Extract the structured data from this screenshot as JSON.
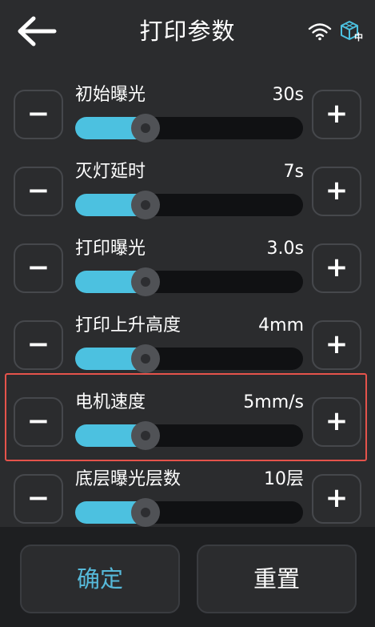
{
  "header": {
    "title": "打印参数",
    "back_icon": "back-arrow-icon",
    "wifi_icon": "wifi-icon",
    "lang_icon": "language-cube-icon",
    "lang_badge": "中"
  },
  "params": [
    {
      "label": "初始曝光",
      "value": "30s",
      "level": 0.31
    },
    {
      "label": "灭灯延时",
      "value": "7s",
      "level": 0.31
    },
    {
      "label": "打印曝光",
      "value": "3.0s",
      "level": 0.31
    },
    {
      "label": "打印上升高度",
      "value": "4mm",
      "level": 0.31
    },
    {
      "label": "电机速度",
      "value": "5mm/s",
      "level": 0.31,
      "selected": true
    },
    {
      "label": "底层曝光层数",
      "value": "10层",
      "level": 0.31
    }
  ],
  "controls": {
    "minus_label": "−",
    "plus_label": "+"
  },
  "footer": {
    "confirm_label": "确定",
    "reset_label": "重置"
  },
  "colors": {
    "accent": "#4cc1e0",
    "confirm_text": "#56b9d9",
    "selection_border": "#e5534b",
    "background": "#2b2c2e"
  }
}
